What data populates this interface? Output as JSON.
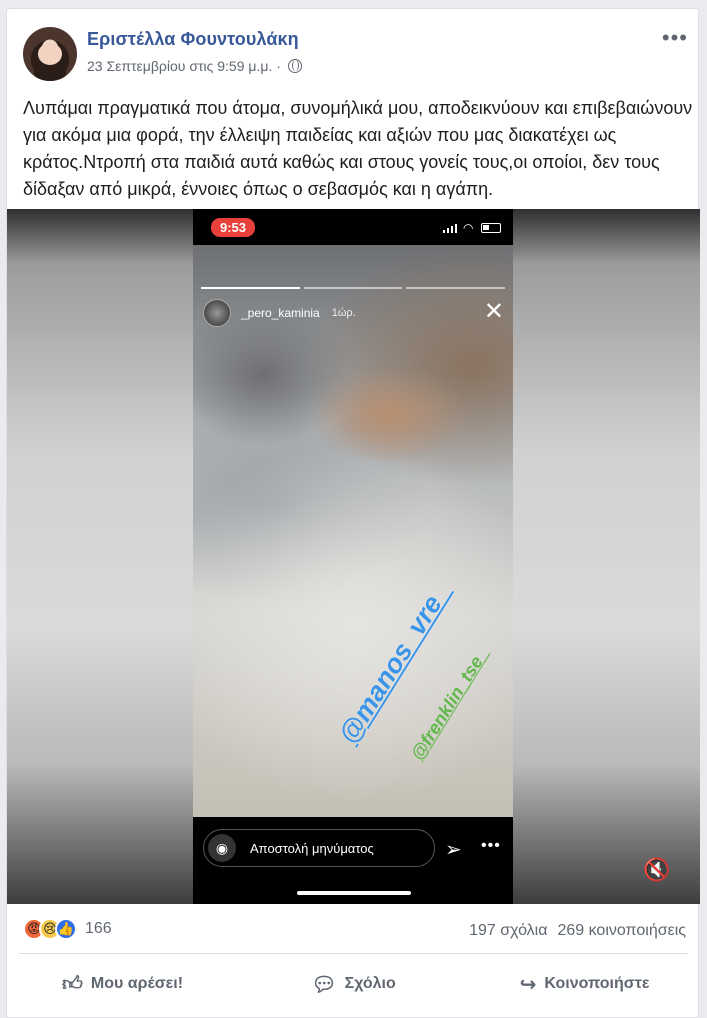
{
  "post": {
    "author": "Εριστέλλα Φουντουλάκη",
    "timestamp": "23 Σεπτεμβρίου στις 9:59 μ.μ.",
    "separator": "·",
    "more_label": "•••",
    "text": "Λυπάμαι πραγματικά που άτομα, συνομήλικά μου, αποδεικνύουν και επιβεβαιώνουν για ακόμα μια φορά, την έλλειψη παιδείας και αξιών που μας διακατέχει ως κράτος.Ντροπή στα παιδιά αυτά καθώς και στους γονείς τους,οι οποίοι, δεν τους δίδαξαν από μικρά, έννοιες όπως ο σεβασμός και η αγάπη."
  },
  "story": {
    "status_time": "9:53",
    "username": "_pero_kaminia",
    "age": "1ώρ.",
    "close_icon": "close-icon",
    "mention_1": "@manos_vre_",
    "mention_2": "@frenklin_tse_",
    "reply_placeholder": "Αποστολή μηνύματος",
    "camera_icon": "camera-icon",
    "send_icon": "send-icon",
    "more_icon": "more-icon",
    "progress_segments": 3,
    "progress_done": 1
  },
  "video": {
    "mute_icon": "mute-icon"
  },
  "stats": {
    "reactions": [
      "angry",
      "sad",
      "like"
    ],
    "reaction_count": "166",
    "comments": "197 σχόλια",
    "shares": "269 κοινοποιήσεις"
  },
  "actions": {
    "like": "Μου αρέσει!",
    "comment": "Σχόλιο",
    "share": "Κοινοποιήστε"
  },
  "colors": {
    "author": "#385898",
    "meta": "#616770",
    "like_blue": "#2e6ee8",
    "angry": "#f0673a",
    "sad": "#f7c94b",
    "mention_1": "#3a94e8",
    "mention_2": "#61b84a",
    "status_pill": "#e8403a"
  }
}
